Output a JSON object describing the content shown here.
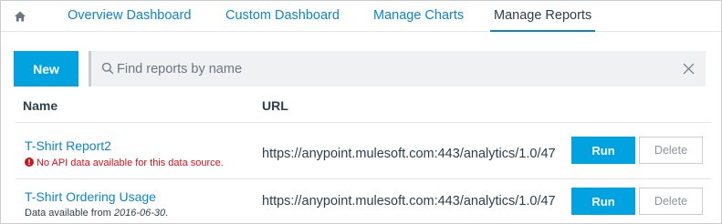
{
  "nav": {
    "home_icon": "home-icon",
    "tabs": [
      {
        "label": "Overview Dashboard",
        "active": false
      },
      {
        "label": "Custom Dashboard",
        "active": false
      },
      {
        "label": "Manage Charts",
        "active": false
      },
      {
        "label": "Manage Reports",
        "active": true
      }
    ]
  },
  "toolbar": {
    "new_label": "New",
    "search_placeholder": "Find reports by name",
    "search_value": ""
  },
  "table": {
    "columns": [
      "Name",
      "URL"
    ],
    "rows": [
      {
        "name": "T-Shirt Report2",
        "status_type": "error",
        "status_text": "No API data available for this data source.",
        "url": "https://anypoint.mulesoft.com:443/analytics/1.0/47",
        "run_label": "Run",
        "delete_label": "Delete"
      },
      {
        "name": "T-Shirt Ordering Usage",
        "status_type": "info",
        "status_prefix": "Data available from ",
        "status_date": "2016-06-30",
        "status_suffix": ".",
        "url": "https://anypoint.mulesoft.com:443/analytics/1.0/47",
        "run_label": "Run",
        "delete_label": "Delete"
      }
    ]
  },
  "colors": {
    "accent": "#00a2df",
    "link": "#0b86c8",
    "error": "#d0121b"
  }
}
